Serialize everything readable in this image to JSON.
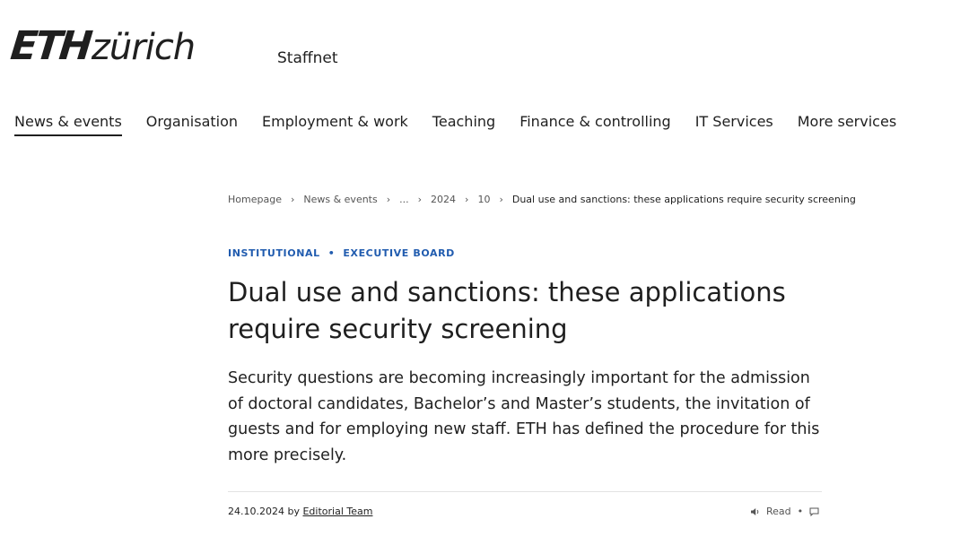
{
  "header": {
    "logo_eth": "ETH",
    "logo_zurich": "zürich",
    "site_name": "Staffnet"
  },
  "nav": {
    "items": [
      {
        "label": "News & events",
        "active": true
      },
      {
        "label": "Organisation"
      },
      {
        "label": "Employment & work"
      },
      {
        "label": "Teaching"
      },
      {
        "label": "Finance & controlling"
      },
      {
        "label": "IT Services"
      },
      {
        "label": "More services"
      }
    ]
  },
  "breadcrumb": {
    "items": [
      "Homepage",
      "News & events",
      "...",
      "2024",
      "10"
    ],
    "current": "Dual use and sanctions: these applications require security screening"
  },
  "article": {
    "tags": [
      "INSTITUTIONAL",
      "EXECUTIVE BOARD"
    ],
    "title": "Dual use and sanctions: these applications require security screening",
    "lead": "Security questions are becoming increasingly important for the admission of doctoral candidates, Bachelor’s and Master’s students, the invitation of guests and for employing new staff. ETH has defined the procedure for this more precisely.",
    "date": "24.10.2024",
    "by": "by",
    "author": "Editorial Team",
    "read_label": "Read"
  },
  "icons": {
    "speaker": "speaker-icon",
    "comment": "comment-icon"
  },
  "colors": {
    "text": "#1f1f1f",
    "accent_blue": "#215caf",
    "muted": "#555555",
    "divider": "#e2e2e2"
  }
}
